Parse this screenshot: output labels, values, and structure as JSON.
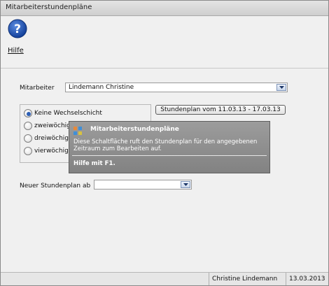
{
  "window": {
    "title": "Mitarbeiterstundenpläne"
  },
  "toolbar": {
    "help_label": "Hilfe"
  },
  "employee": {
    "label": "Mitarbeiter",
    "value": "Lindemann Christine"
  },
  "shift_options": [
    {
      "label": "Keine Wechselschicht",
      "selected": true
    },
    {
      "label": "zweiwöchige",
      "selected": false
    },
    {
      "label": "dreiwöchige",
      "selected": false
    },
    {
      "label": "vierwöchige",
      "selected": false
    }
  ],
  "schedule_button": {
    "label": "Stundenplan vom 11.03.13 - 17.03.13"
  },
  "tooltip": {
    "title": "Mitarbeiterstundenpläne",
    "body": "Diese Schaltfläche ruft den Stundenplan für den angegebenen Zeitraum zum Bearbeiten auf.",
    "footer": "Hilfe mit F1."
  },
  "new_schedule": {
    "label": "Neuer Stundenplan ab",
    "value": ""
  },
  "status": {
    "user": "Christine Lindemann",
    "date": "13.03.2013"
  },
  "colors": {
    "accent": "#2d5fb5",
    "tooltip_bg": "#8f8f8f"
  }
}
